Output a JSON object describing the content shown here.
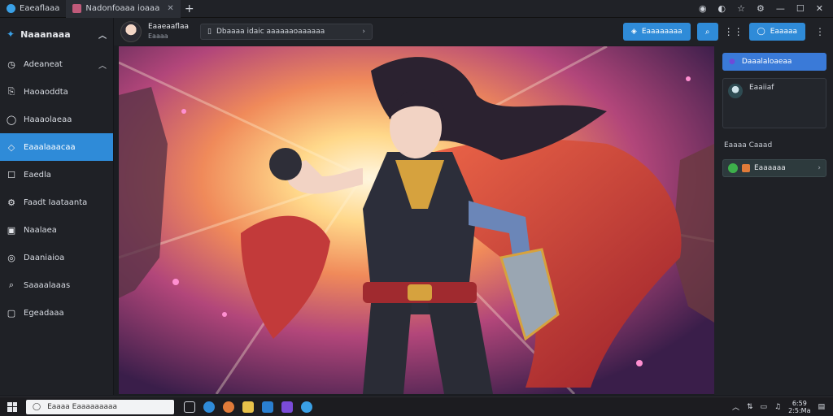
{
  "titlebar": {
    "tabs": [
      {
        "label": "Eaeaflaaa"
      },
      {
        "label": "Nadonfoaaa  ioaaa"
      }
    ],
    "new_tab": "+",
    "controls": {
      "minimize": "—",
      "maximize": "☐",
      "close": "✕"
    }
  },
  "sidebar": {
    "header": "Naaanaaa",
    "items": [
      {
        "label": "Adeaneat",
        "icon": "clock-icon"
      },
      {
        "label": "Haoaoddta",
        "icon": "bookmark-icon"
      },
      {
        "label": "Haaaolaeaa",
        "icon": "chat-icon"
      },
      {
        "label": "Eaaalaaacaa",
        "icon": "tag-icon"
      },
      {
        "label": "Eaedla",
        "icon": "square-icon"
      },
      {
        "label": "Faadt Iaataanta",
        "icon": "gear-icon"
      },
      {
        "label": "Naalaea",
        "icon": "image-icon"
      },
      {
        "label": "Daaniaioa",
        "icon": "compass-icon"
      },
      {
        "label": "Saaaalaaas",
        "icon": "search-icon"
      },
      {
        "label": "Egeadaaa",
        "icon": "folder-icon"
      }
    ]
  },
  "header": {
    "user_name": "Eaaeaaflaa",
    "user_sub": "Eaaaa",
    "prompt": "Dbaaaa idaic aaaaaaoaaaaaa",
    "primary_button": "Eaaaaaaaa",
    "secondary_button": "Eaaaaa"
  },
  "right_panel": {
    "button": "Daaalaloaeaa",
    "card_title": "Eaaiiaf",
    "section_label": "Eaaaa Caaad",
    "item_label": "Eaaaaaa"
  },
  "taskbar": {
    "search_placeholder": "Eaaaa Eaaaaaaaaa",
    "clock_time": "6:59",
    "clock_date": "2:5:Ma"
  },
  "colors": {
    "accent": "#2f8bd8",
    "panel": "#1f2126",
    "background": "#1b1d22"
  }
}
